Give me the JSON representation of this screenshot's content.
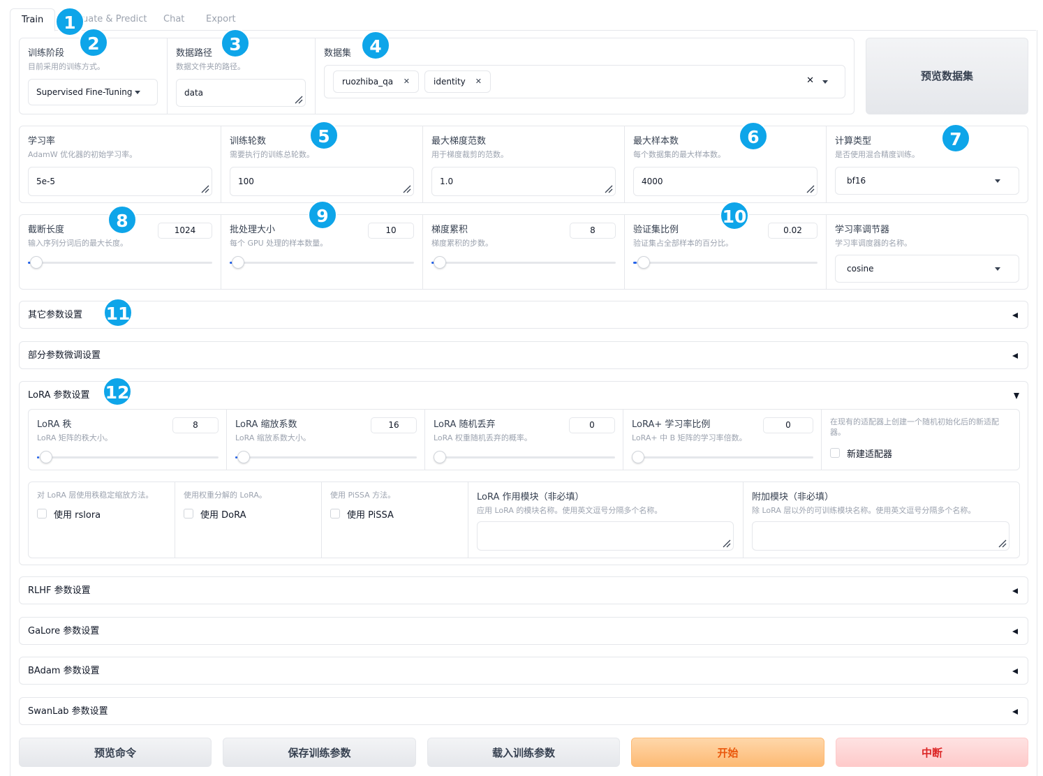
{
  "tabs": [
    {
      "label": "Train"
    },
    {
      "label": "uate & Predict"
    },
    {
      "label": "Chat"
    },
    {
      "label": "Export"
    }
  ],
  "row1": {
    "stage": {
      "label": "训练阶段",
      "info": "目前采用的训练方式。",
      "value": "Supervised Fine-Tuning"
    },
    "data_dir": {
      "label": "数据路径",
      "info": "数据文件夹的路径。",
      "value": "data"
    },
    "dataset": {
      "label": "数据集",
      "chips": [
        "ruozhiba_qa",
        "identity"
      ]
    },
    "preview_button": "预览数据集"
  },
  "row2": {
    "learning_rate": {
      "label": "学习率",
      "info": "AdamW 优化器的初始学习率。",
      "value": "5e-5"
    },
    "epochs": {
      "label": "训练轮数",
      "info": "需要执行的训练总轮数。",
      "value": "100"
    },
    "max_grad_norm": {
      "label": "最大梯度范数",
      "info": "用于梯度裁剪的范数。",
      "value": "1.0"
    },
    "max_samples": {
      "label": "最大样本数",
      "info": "每个数据集的最大样本数。",
      "value": "4000"
    },
    "compute_type": {
      "label": "计算类型",
      "info": "是否使用混合精度训练。",
      "value": "bf16"
    }
  },
  "row3": {
    "cutoff_len": {
      "label": "截断长度",
      "info": "输入序列分词后的最大长度。",
      "value": "1024",
      "fraction": 0.02
    },
    "batch_size": {
      "label": "批处理大小",
      "info": "每个 GPU 处理的样本数量。",
      "value": "10",
      "fraction": 0.02
    },
    "grad_accum": {
      "label": "梯度累积",
      "info": "梯度累积的步数。",
      "value": "8",
      "fraction": 0.02
    },
    "val_size": {
      "label": "验证集比例",
      "info": "验证集占全部样本的百分比。",
      "value": "0.02",
      "fraction": 0.02
    },
    "lr_scheduler": {
      "label": "学习率调节器",
      "info": "学习率调度器的名称。",
      "value": "cosine"
    }
  },
  "accordions": {
    "extra": "其它参数设置",
    "freeze": "部分参数微调设置",
    "lora": "LoRA 参数设置",
    "rlhf": "RLHF 参数设置",
    "galore": "GaLore 参数设置",
    "badam": "BAdam 参数设置",
    "swanlab": "SwanLab 参数设置"
  },
  "lora": {
    "rank": {
      "label": "LoRA 秩",
      "info": "LoRA 矩阵的秩大小。",
      "value": "8"
    },
    "alpha": {
      "label": "LoRA 缩放系数",
      "info": "LoRA 缩放系数大小。",
      "value": "16"
    },
    "dropout": {
      "label": "LoRA 随机丢弃",
      "info": "LoRA 权重随机丢弃的概率。",
      "value": "0"
    },
    "plus_lr": {
      "label": "LoRA+ 学习率比例",
      "info": "LoRA+ 中 B 矩阵的学习率倍数。",
      "value": "0"
    },
    "new_adapter": {
      "info": "在现有的适配器上创建一个随机初始化后的新适配器。",
      "label": "新建适配器"
    },
    "rslora": {
      "info": "对 LoRA 层使用秩稳定缩放方法。",
      "label": "使用 rslora"
    },
    "dora": {
      "info": "使用权重分解的 LoRA。",
      "label": "使用 DoRA"
    },
    "pissa": {
      "info": "使用 PiSSA 方法。",
      "label": "使用 PiSSA"
    },
    "target": {
      "label": "LoRA 作用模块（非必填）",
      "info": "应用 LoRA 的模块名称。使用英文逗号分隔多个名称。"
    },
    "additional": {
      "label": "附加模块（非必填）",
      "info": "除 LoRA 层以外的可训练模块名称。使用英文逗号分隔多个名称。"
    }
  },
  "buttons": {
    "preview_cmd": "预览命令",
    "save_args": "保存训练参数",
    "load_args": "载入训练参数",
    "start": "开始",
    "stop": "中断"
  },
  "badges": [
    "1",
    "2",
    "3",
    "4",
    "5",
    "6",
    "7",
    "8",
    "9",
    "10",
    "11",
    "12"
  ],
  "colors": {
    "badge": "#0ea5e9",
    "start": "#ea580c",
    "stop": "#dc2626",
    "slider_fill": "#2563eb"
  }
}
